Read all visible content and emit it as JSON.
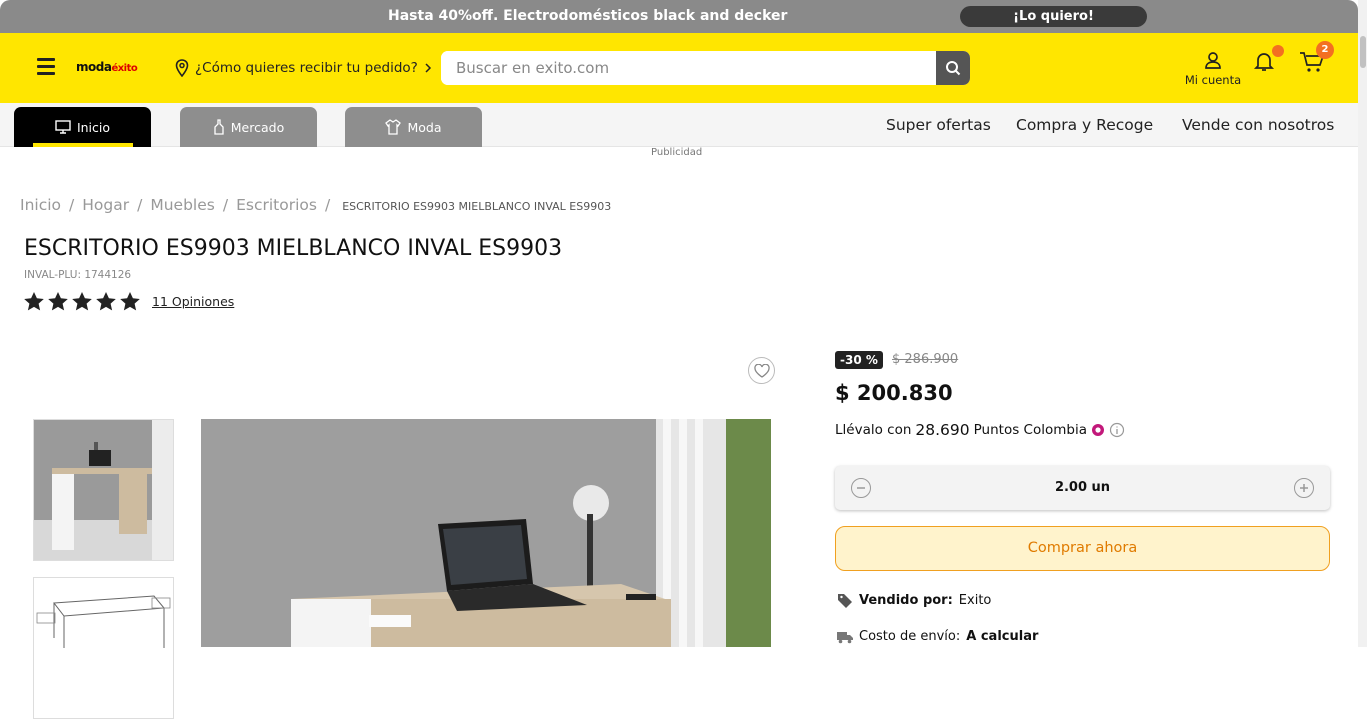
{
  "promo": {
    "text": "Hasta 40%off. Electrodomésticos black and decker",
    "cta": "¡Lo quiero!"
  },
  "header": {
    "logo_text": "moda",
    "logo_brand": "éxito",
    "delivery_prompt": "¿Cómo quieres recibir tu pedido?",
    "search_placeholder": "Buscar en exito.com",
    "account_label": "Mi cuenta",
    "cart_count": "2"
  },
  "nav": {
    "tabs": [
      {
        "label": "Inicio",
        "icon": "monitor-icon"
      },
      {
        "label": "Mercado",
        "icon": "bottle-icon"
      },
      {
        "label": "Moda",
        "icon": "shirt-icon"
      }
    ],
    "links": [
      "Super ofertas",
      "Compra y Recoge",
      "Vende con nosotros"
    ],
    "advertising": "Publicidad"
  },
  "breadcrumb": {
    "items": [
      "Inicio",
      "Hogar",
      "Muebles",
      "Escritorios"
    ],
    "separator": "/",
    "current": "ESCRITORIO ES9903 MIELBLANCO INVAL ES9903"
  },
  "product": {
    "title": "ESCRITORIO ES9903 MIELBLANCO INVAL ES9903",
    "plu": "INVAL-PLU: 1744126",
    "rating": 5,
    "reviews": "11 Opiniones",
    "discount": "-30 %",
    "old_price": "$ 286.900",
    "price": "$ 200.830",
    "points_prefix": "Llévalo con",
    "points_value": "28.690",
    "points_suffix": "Puntos Colombia",
    "quantity": "2.00 un",
    "buy_label": "Comprar ahora",
    "sold_by_label": "Vendido por:",
    "sold_by_value": "Exito",
    "shipping_label": "Costo de envío:",
    "shipping_value": "A calcular"
  },
  "colors": {
    "brand_yellow": "#ffe600",
    "accent_orange": "#f36f21",
    "dark": "#222222"
  }
}
